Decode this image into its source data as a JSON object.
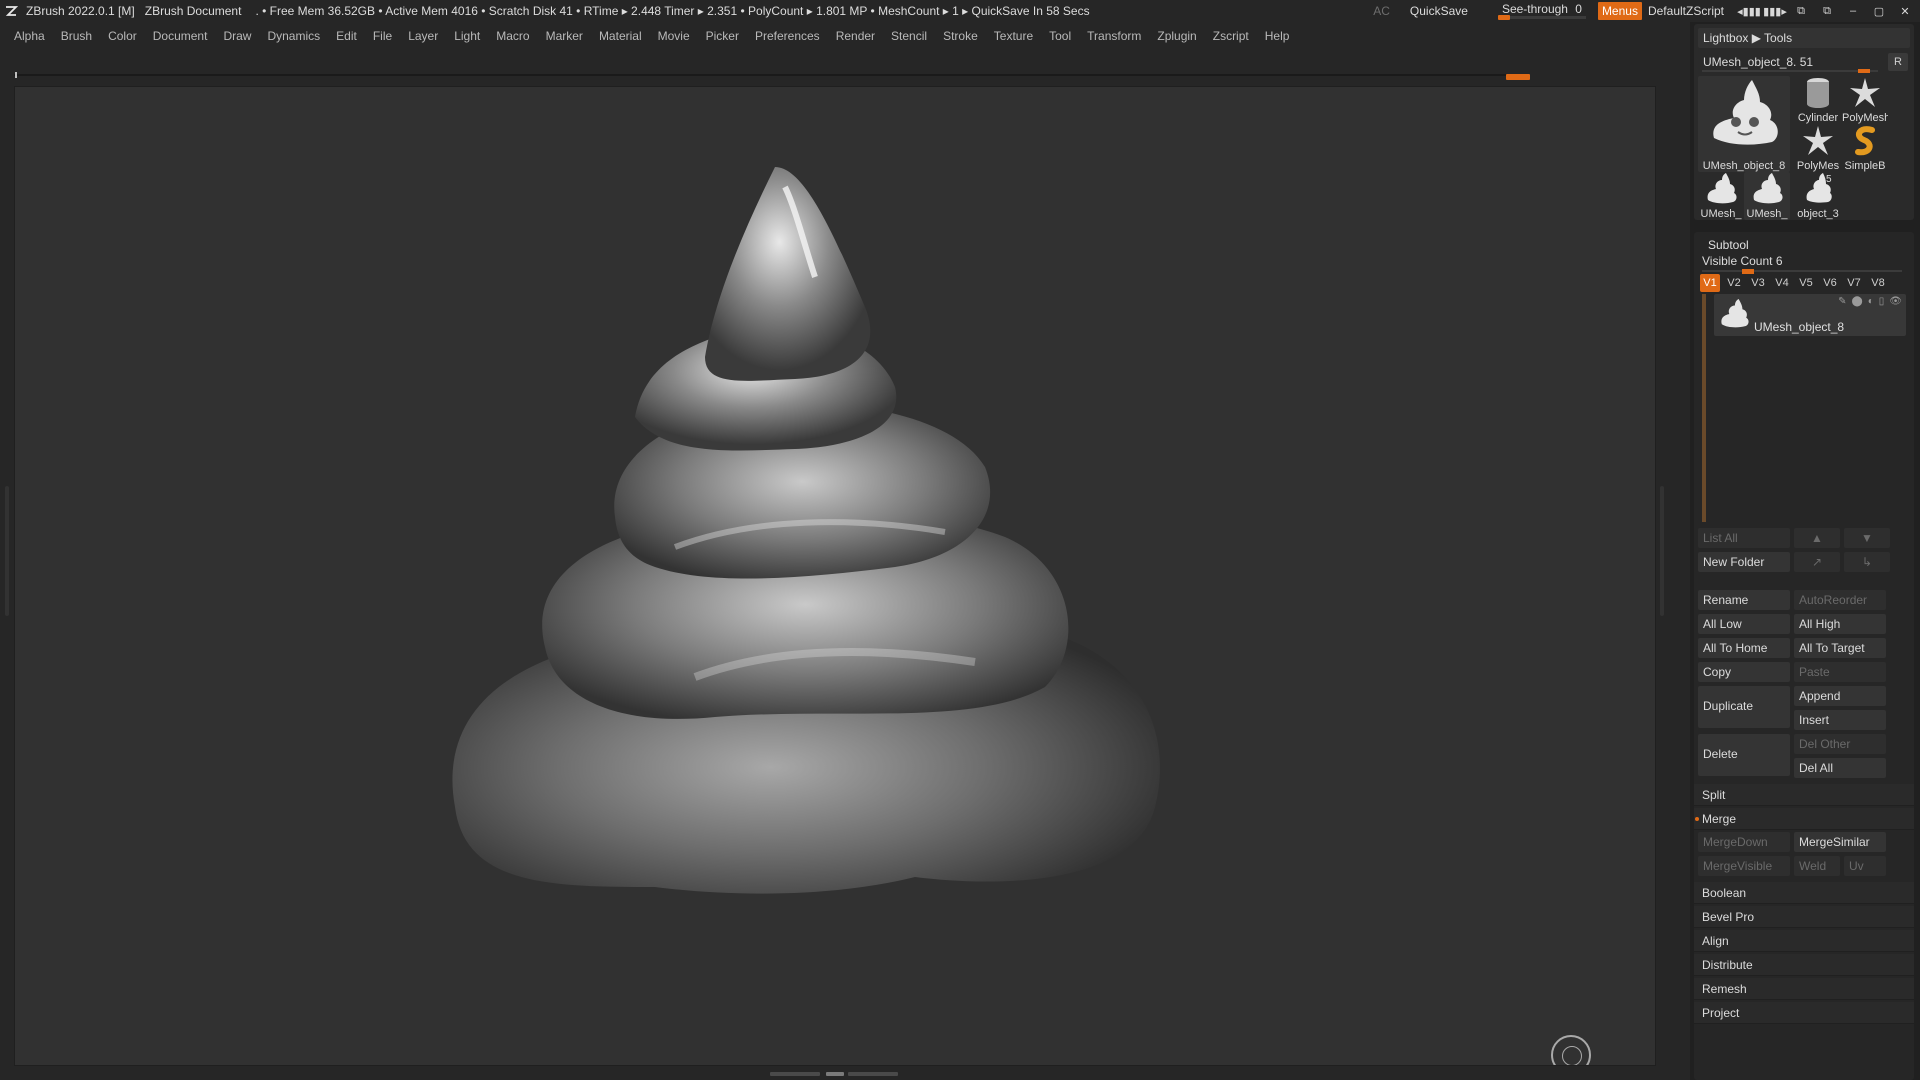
{
  "titlebar": {
    "app": "ZBrush 2022.0.1 [M]",
    "document": "ZBrush Document",
    "stats": ". • Free Mem 36.52GB • Active Mem 4016 • Scratch Disk 41 •  RTime ▸ 2.448 Timer ▸ 2.351 • PolyCount ▸ 1.801 MP  • MeshCount ▸ 1  ▸ QuickSave In 58 Secs",
    "ac": "AC",
    "quicksave": "QuickSave",
    "see_through_label": "See-through",
    "see_through_value": "0",
    "menus": "Menus",
    "default_zscript": "DefaultZScript"
  },
  "menubar": [
    "Alpha",
    "Brush",
    "Color",
    "Document",
    "Draw",
    "Dynamics",
    "Edit",
    "File",
    "Layer",
    "Light",
    "Macro",
    "Marker",
    "Material",
    "Movie",
    "Picker",
    "Preferences",
    "Render",
    "Stencil",
    "Stroke",
    "Texture",
    "Tool",
    "Transform",
    "Zplugin",
    "Zscript",
    "Help"
  ],
  "lightbox": {
    "title": "Lightbox ▶ Tools",
    "tool_name": "UMesh_object_8. 51",
    "r_button": "R",
    "thumbs": [
      {
        "label": "UMesh_object_8",
        "icon": "umesh-thumb-icon"
      },
      {
        "label": "Cylinder",
        "icon": "cylinder-icon"
      },
      {
        "label": "PolyMesh",
        "icon": "polymesh-star-icon"
      },
      {
        "label": "PolyMes",
        "icon": "polymesh-star-icon"
      },
      {
        "label": "SimpleB",
        "icon": "simplebrush-icon"
      },
      {
        "label": "UMesh_",
        "icon": "umesh-thumb-icon"
      },
      {
        "label": "UMesh_",
        "icon": "umesh-thumb-icon"
      },
      {
        "label": "object_3",
        "icon": "umesh-thumb-icon",
        "badge": "5"
      }
    ]
  },
  "subtool": {
    "title": "Subtool",
    "visible_count": "Visible Count 6",
    "tabs": [
      "V1",
      "V2",
      "V3",
      "V4",
      "V5",
      "V6",
      "V7",
      "V8"
    ],
    "active_tab": "V1",
    "items": [
      {
        "name": "UMesh_object_8"
      }
    ],
    "list_all": "List All",
    "new_folder": "New Folder",
    "rename": "Rename",
    "auto_reorder": "AutoReorder",
    "all_low": "All Low",
    "all_high": "All High",
    "all_to_home": "All To Home",
    "all_to_target": "All To Target",
    "copy": "Copy",
    "paste": "Paste",
    "duplicate": "Duplicate",
    "append": "Append",
    "insert": "Insert",
    "delete": "Delete",
    "del_other": "Del Other",
    "del_all": "Del All",
    "split": "Split",
    "merge": "Merge",
    "merge_down": "MergeDown",
    "merge_similar": "MergeSimilar",
    "merge_visible": "MergeVisible",
    "weld": "Weld",
    "uv": "Uv",
    "boolean": "Boolean",
    "bevel_pro": "Bevel Pro",
    "align": "Align",
    "distribute": "Distribute",
    "remesh": "Remesh",
    "project": "Project"
  },
  "colors": {
    "accent": "#e06a16",
    "canvas": "#313131",
    "ui": "#262626"
  }
}
